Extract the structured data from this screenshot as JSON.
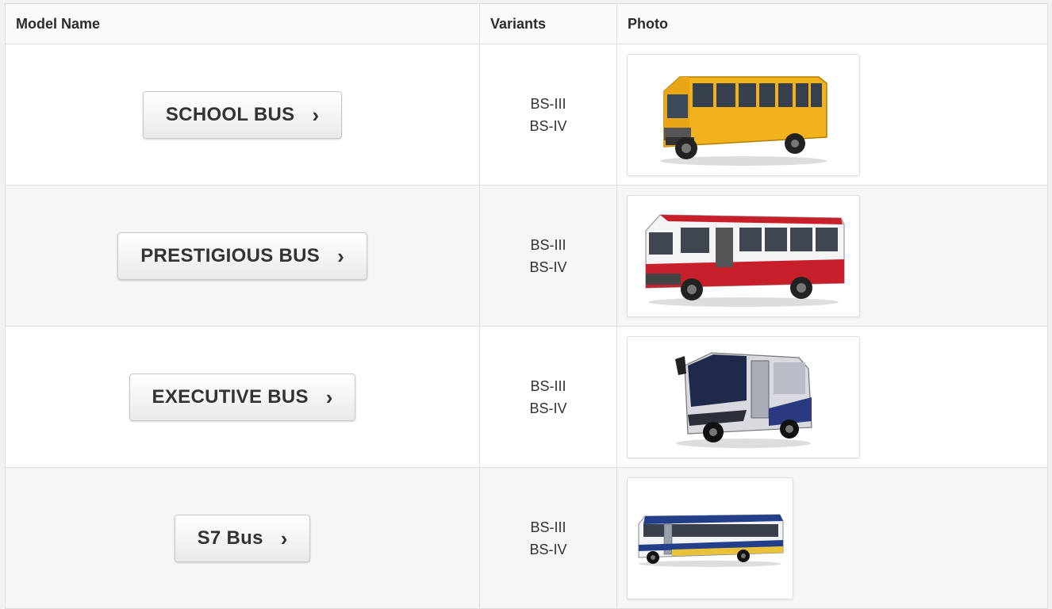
{
  "table": {
    "headers": {
      "model": "Model Name",
      "variants": "Variants",
      "photo": "Photo"
    },
    "rows": [
      {
        "model": "SCHOOL BUS",
        "variants": [
          "BS-III",
          "BS-IV"
        ],
        "photo_icon": "yellow-school-bus-image"
      },
      {
        "model": "PRESTIGIOUS BUS",
        "variants": [
          "BS-III",
          "BS-IV"
        ],
        "photo_icon": "red-white-bus-image"
      },
      {
        "model": "EXECUTIVE BUS",
        "variants": [
          "BS-III",
          "BS-IV"
        ],
        "photo_icon": "executive-coach-image"
      },
      {
        "model": "S7 Bus",
        "variants": [
          "BS-III",
          "BS-IV"
        ],
        "photo_icon": "city-bus-image"
      }
    ]
  },
  "colors": {
    "school_bus": "#f2b21b",
    "prestige_red": "#c8202a",
    "executive_blue": "#2b3a80",
    "city_blue": "#233f8a"
  },
  "chevron": "›"
}
